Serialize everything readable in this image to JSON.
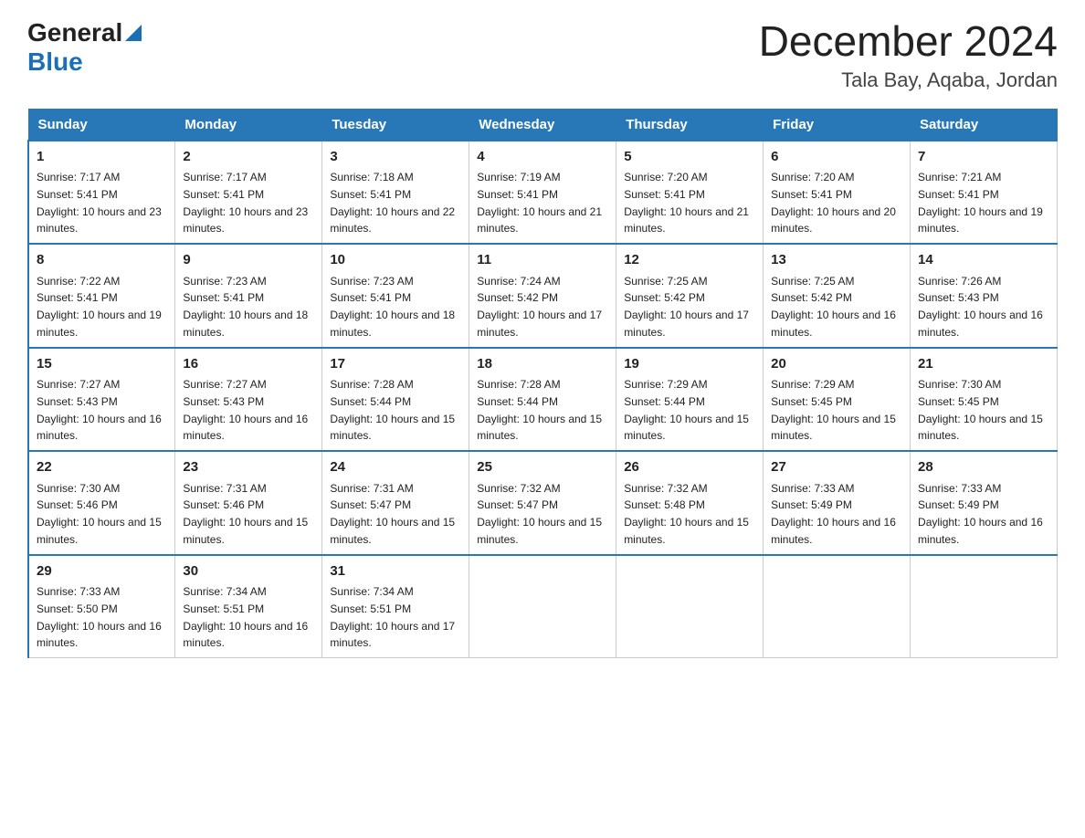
{
  "header": {
    "logo": {
      "general": "General",
      "blue": "Blue",
      "triangle": true
    },
    "month_title": "December 2024",
    "location": "Tala Bay, Aqaba, Jordan"
  },
  "weekdays": [
    "Sunday",
    "Monday",
    "Tuesday",
    "Wednesday",
    "Thursday",
    "Friday",
    "Saturday"
  ],
  "weeks": [
    [
      {
        "day": "1",
        "sunrise": "7:17 AM",
        "sunset": "5:41 PM",
        "daylight": "10 hours and 23 minutes."
      },
      {
        "day": "2",
        "sunrise": "7:17 AM",
        "sunset": "5:41 PM",
        "daylight": "10 hours and 23 minutes."
      },
      {
        "day": "3",
        "sunrise": "7:18 AM",
        "sunset": "5:41 PM",
        "daylight": "10 hours and 22 minutes."
      },
      {
        "day": "4",
        "sunrise": "7:19 AM",
        "sunset": "5:41 PM",
        "daylight": "10 hours and 21 minutes."
      },
      {
        "day": "5",
        "sunrise": "7:20 AM",
        "sunset": "5:41 PM",
        "daylight": "10 hours and 21 minutes."
      },
      {
        "day": "6",
        "sunrise": "7:20 AM",
        "sunset": "5:41 PM",
        "daylight": "10 hours and 20 minutes."
      },
      {
        "day": "7",
        "sunrise": "7:21 AM",
        "sunset": "5:41 PM",
        "daylight": "10 hours and 19 minutes."
      }
    ],
    [
      {
        "day": "8",
        "sunrise": "7:22 AM",
        "sunset": "5:41 PM",
        "daylight": "10 hours and 19 minutes."
      },
      {
        "day": "9",
        "sunrise": "7:23 AM",
        "sunset": "5:41 PM",
        "daylight": "10 hours and 18 minutes."
      },
      {
        "day": "10",
        "sunrise": "7:23 AM",
        "sunset": "5:41 PM",
        "daylight": "10 hours and 18 minutes."
      },
      {
        "day": "11",
        "sunrise": "7:24 AM",
        "sunset": "5:42 PM",
        "daylight": "10 hours and 17 minutes."
      },
      {
        "day": "12",
        "sunrise": "7:25 AM",
        "sunset": "5:42 PM",
        "daylight": "10 hours and 17 minutes."
      },
      {
        "day": "13",
        "sunrise": "7:25 AM",
        "sunset": "5:42 PM",
        "daylight": "10 hours and 16 minutes."
      },
      {
        "day": "14",
        "sunrise": "7:26 AM",
        "sunset": "5:43 PM",
        "daylight": "10 hours and 16 minutes."
      }
    ],
    [
      {
        "day": "15",
        "sunrise": "7:27 AM",
        "sunset": "5:43 PM",
        "daylight": "10 hours and 16 minutes."
      },
      {
        "day": "16",
        "sunrise": "7:27 AM",
        "sunset": "5:43 PM",
        "daylight": "10 hours and 16 minutes."
      },
      {
        "day": "17",
        "sunrise": "7:28 AM",
        "sunset": "5:44 PM",
        "daylight": "10 hours and 15 minutes."
      },
      {
        "day": "18",
        "sunrise": "7:28 AM",
        "sunset": "5:44 PM",
        "daylight": "10 hours and 15 minutes."
      },
      {
        "day": "19",
        "sunrise": "7:29 AM",
        "sunset": "5:44 PM",
        "daylight": "10 hours and 15 minutes."
      },
      {
        "day": "20",
        "sunrise": "7:29 AM",
        "sunset": "5:45 PM",
        "daylight": "10 hours and 15 minutes."
      },
      {
        "day": "21",
        "sunrise": "7:30 AM",
        "sunset": "5:45 PM",
        "daylight": "10 hours and 15 minutes."
      }
    ],
    [
      {
        "day": "22",
        "sunrise": "7:30 AM",
        "sunset": "5:46 PM",
        "daylight": "10 hours and 15 minutes."
      },
      {
        "day": "23",
        "sunrise": "7:31 AM",
        "sunset": "5:46 PM",
        "daylight": "10 hours and 15 minutes."
      },
      {
        "day": "24",
        "sunrise": "7:31 AM",
        "sunset": "5:47 PM",
        "daylight": "10 hours and 15 minutes."
      },
      {
        "day": "25",
        "sunrise": "7:32 AM",
        "sunset": "5:47 PM",
        "daylight": "10 hours and 15 minutes."
      },
      {
        "day": "26",
        "sunrise": "7:32 AM",
        "sunset": "5:48 PM",
        "daylight": "10 hours and 15 minutes."
      },
      {
        "day": "27",
        "sunrise": "7:33 AM",
        "sunset": "5:49 PM",
        "daylight": "10 hours and 16 minutes."
      },
      {
        "day": "28",
        "sunrise": "7:33 AM",
        "sunset": "5:49 PM",
        "daylight": "10 hours and 16 minutes."
      }
    ],
    [
      {
        "day": "29",
        "sunrise": "7:33 AM",
        "sunset": "5:50 PM",
        "daylight": "10 hours and 16 minutes."
      },
      {
        "day": "30",
        "sunrise": "7:34 AM",
        "sunset": "5:51 PM",
        "daylight": "10 hours and 16 minutes."
      },
      {
        "day": "31",
        "sunrise": "7:34 AM",
        "sunset": "5:51 PM",
        "daylight": "10 hours and 17 minutes."
      },
      null,
      null,
      null,
      null
    ]
  ]
}
